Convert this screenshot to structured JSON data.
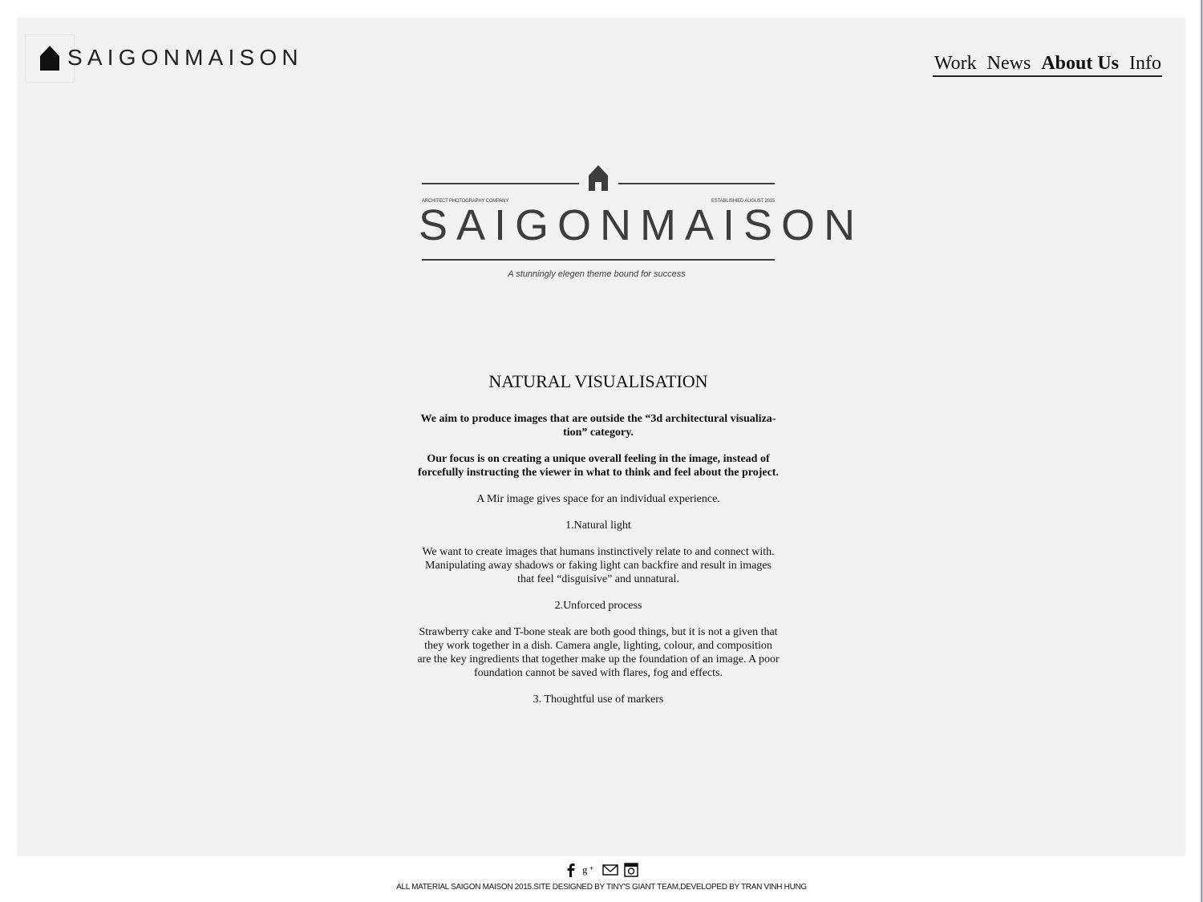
{
  "header": {
    "logo_text": "SAIGONMAISON",
    "logo_icon": "house-icon"
  },
  "nav": {
    "items": [
      {
        "label": "Work",
        "active": false
      },
      {
        "label": "News",
        "active": false
      },
      {
        "label": "About Us",
        "active": true
      },
      {
        "label": "Info",
        "active": false
      }
    ]
  },
  "emblem": {
    "icon": "house-icon",
    "left_caption": "ARCHITECT PHOTOGRAPHY COMPANY",
    "right_caption": "ESTABLISHIED AUGUST 2015",
    "title": "SAIGONMAISON",
    "tagline": "A stunningly elegen theme bound for success"
  },
  "main": {
    "heading": "NATURAL VISUALISATION",
    "paragraphs": [
      "We aim to produce images that are outside the “3d architectural visualiza­tion” category.",
      "Our focus is on creating a unique overall feeling in the image, instead of forcefully instructing the viewer in what to think and feel about the project.",
      "A Mir image gives space for an individual experience.",
      "1.Natural light",
      "We want to create images that humans instinctively relate to and connect with. Manipulating away shadows or faking light can backfire and result in images that feel “disguisive” and unnatural.",
      "2.Unforced process",
      "Strawberry cake and T-bone steak are both good things, but it is not a given that they work together in a dish. Camera angle, lighting, colour, and composition are the key ingredients that together make up the foundation of an image. A poor foundation cannot be saved with flares, fog and effects.",
      "3. Thoughtful use of markers"
    ]
  },
  "footer": {
    "social_icons": [
      "facebook-icon",
      "google-plus-icon",
      "email-icon",
      "instagram-icon"
    ],
    "copyright": "ALL MATERIAL SAIGON MAISON 2015.SITE DESIGNED BY TINY'S GIANT TEAM,DEVELOPED BY TRAN VINH HUNG"
  }
}
